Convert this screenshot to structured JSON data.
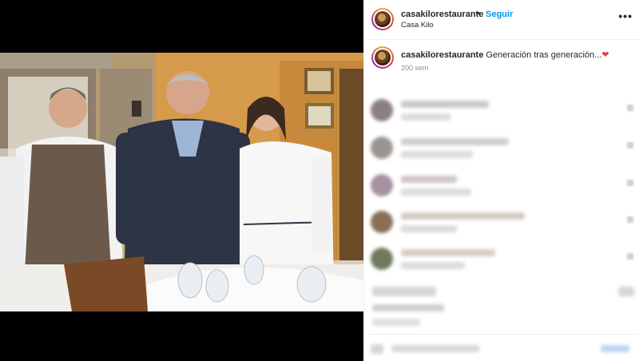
{
  "header": {
    "username": "casakilorestaurante",
    "separator": "•",
    "follow_label": "Seguir",
    "location": "Casa Kilo",
    "more_icon": "more-horizontal-icon"
  },
  "caption": {
    "username": "casakilorestaurante",
    "text": "Generación tras generación...",
    "emoji": "❤",
    "time": "200 sem"
  },
  "colors": {
    "link_blue": "#0095f6",
    "text": "#262626",
    "muted": "#8e8e8e",
    "divider": "#efefef"
  }
}
